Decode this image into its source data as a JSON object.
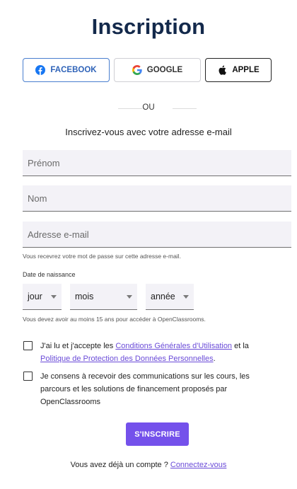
{
  "page": {
    "title": "Inscription"
  },
  "social": {
    "facebook": "FACEBOOK",
    "google": "GOOGLE",
    "apple": "APPLE"
  },
  "divider": "OU",
  "form": {
    "subtitle": "Inscrivez-vous avec votre adresse e-mail",
    "first_name_placeholder": "Prénom",
    "last_name_placeholder": "Nom",
    "email_placeholder": "Adresse e-mail",
    "email_hint": "Vous recevrez votre mot de passe sur cette adresse e-mail.",
    "dob_label": "Date de naissance",
    "day": "jour",
    "month": "mois",
    "year": "année",
    "age_hint": "Vous devez avoir au moins 15 ans pour accéder à OpenClassrooms."
  },
  "terms": {
    "prefix": "J'ai lu et j'accepte les ",
    "cgu_link": "Conditions Générales d'Utilisation",
    "middle": " et la ",
    "privacy_link": "Politique de Protection des Données Personnelles",
    "suffix": "."
  },
  "consent": "Je consens à recevoir des communications sur les cours, les parcours et les solutions de financement proposés par OpenClassrooms",
  "submit_label": "S'INSCRIRE",
  "login": {
    "text": "Vous avez déjà un compte ? ",
    "link": "Connectez-vous"
  },
  "colors": {
    "title": "#13294b",
    "accent": "#7451eb",
    "facebook": "#2f63b8",
    "link": "#6a4bd8"
  }
}
